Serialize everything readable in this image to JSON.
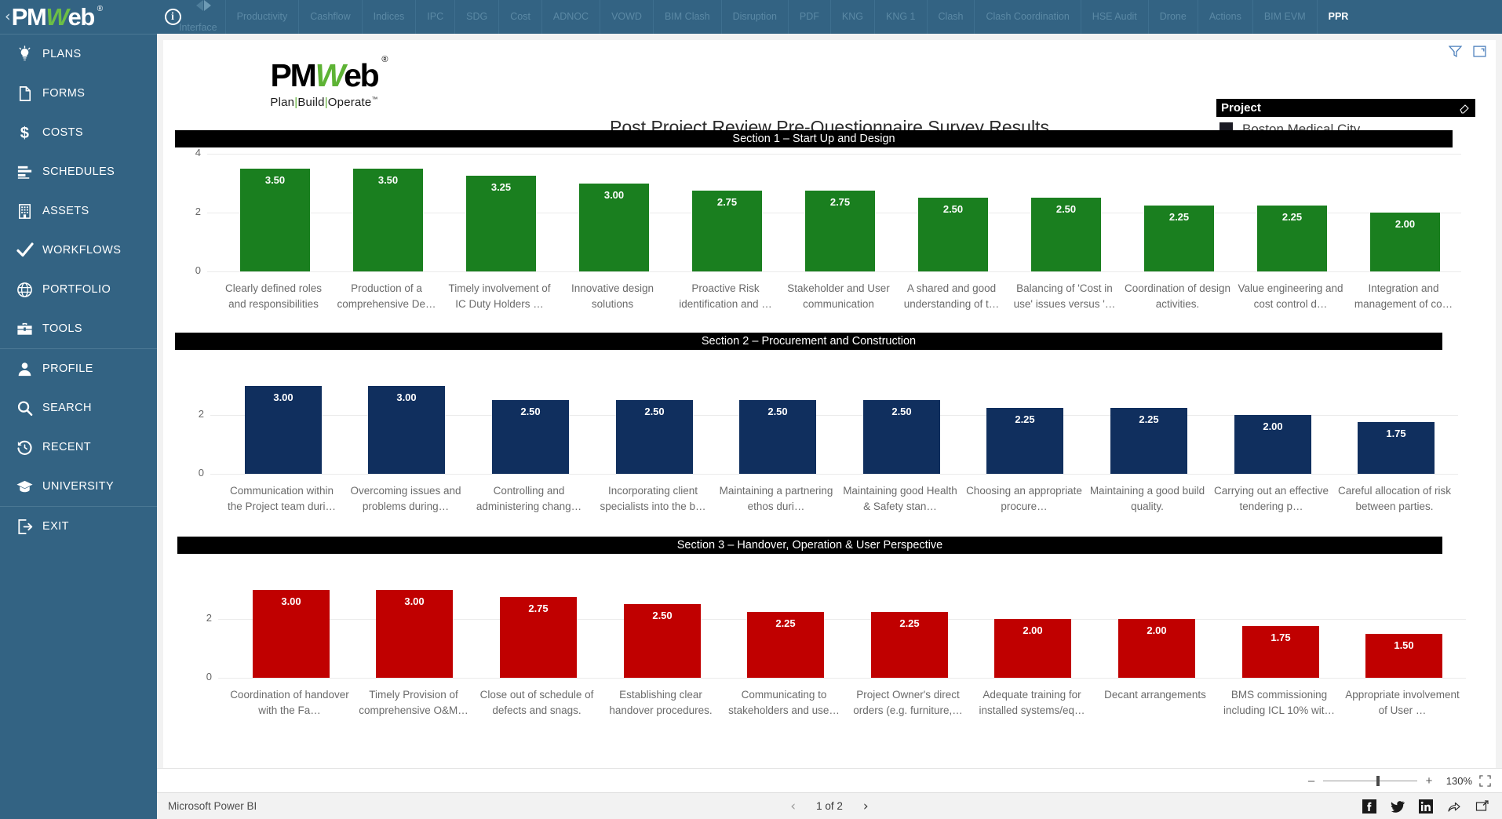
{
  "brand": {
    "chevron": "‹",
    "name_pm": "PM",
    "name_w": "W",
    "name_eb": "eb",
    "reg": "®"
  },
  "topbar": {
    "info_icon": "i",
    "tabs": [
      {
        "label": "Interface",
        "active": false,
        "nav": true
      },
      {
        "label": "Productivity",
        "active": false
      },
      {
        "label": "Cashflow",
        "active": false
      },
      {
        "label": "Indices",
        "active": false
      },
      {
        "label": "IPC",
        "active": false
      },
      {
        "label": "SDG",
        "active": false
      },
      {
        "label": "Cost",
        "active": false
      },
      {
        "label": "ADNOC",
        "active": false
      },
      {
        "label": "VOWD",
        "active": false
      },
      {
        "label": "BIM Clash",
        "active": false
      },
      {
        "label": "Disruption",
        "active": false
      },
      {
        "label": "PDF",
        "active": false
      },
      {
        "label": "KNG",
        "active": false
      },
      {
        "label": "KNG 1",
        "active": false
      },
      {
        "label": "Clash",
        "active": false
      },
      {
        "label": "Clash Coordination",
        "active": false
      },
      {
        "label": "HSE Audit",
        "active": false
      },
      {
        "label": "Drone",
        "active": false
      },
      {
        "label": "Actions",
        "active": false
      },
      {
        "label": "BIM EVM",
        "active": false
      },
      {
        "label": "PPR",
        "active": true
      }
    ]
  },
  "sidebar": {
    "items": [
      {
        "label": "PLANS",
        "icon": "lightbulb-icon"
      },
      {
        "label": "FORMS",
        "icon": "document-icon"
      },
      {
        "label": "COSTS",
        "icon": "dollar-icon"
      },
      {
        "label": "SCHEDULES",
        "icon": "gantt-icon"
      },
      {
        "label": "ASSETS",
        "icon": "building-icon"
      },
      {
        "label": "WORKFLOWS",
        "icon": "check-icon"
      },
      {
        "label": "PORTFOLIO",
        "icon": "globe-icon"
      },
      {
        "label": "TOOLS",
        "icon": "toolbox-icon"
      }
    ],
    "items2": [
      {
        "label": "PROFILE",
        "icon": "person-icon"
      },
      {
        "label": "SEARCH",
        "icon": "magnifier-icon"
      },
      {
        "label": "RECENT",
        "icon": "history-icon"
      },
      {
        "label": "UNIVERSITY",
        "icon": "graduation-cap-icon"
      }
    ],
    "items3": [
      {
        "label": "EXIT",
        "icon": "exit-icon"
      }
    ]
  },
  "report": {
    "logo": {
      "pm": "PM",
      "w": "W",
      "eb": "eb",
      "reg": "®",
      "tagline_plan": "Plan",
      "tagline_build": "Build",
      "tagline_operate": "Operate",
      "tm": "™",
      "sep": "|"
    },
    "title": "Post Project Review Pre-Questionnaire Survey Results",
    "slicer": {
      "header": "Project",
      "eraser_icon": "eraser-icon",
      "value": "Boston Medical City"
    },
    "toolbar": {
      "filter_icon": "filter-icon",
      "focus_icon": "focus-mode-icon"
    }
  },
  "zoombar": {
    "minus": "–",
    "plus": "+",
    "percent": "130%",
    "fit_icon": "fit-to-page-icon"
  },
  "statusbar": {
    "product": "Microsoft Power BI",
    "prev_icon": "chevron-left-icon",
    "next_icon": "chevron-right-icon",
    "page": "1 of 2",
    "share_icons": [
      "facebook-icon",
      "twitter-icon",
      "linkedin-icon",
      "share-icon",
      "popout-icon"
    ]
  },
  "chart_data": [
    {
      "type": "bar",
      "title": "Section 1 – Start Up and Design",
      "color": "#1a7f1f",
      "ylim": [
        0,
        4
      ],
      "yticks": [
        0,
        2,
        4
      ],
      "grid": true,
      "xlabel": "",
      "ylabel": "",
      "categories": [
        "Clearly defined roles and responsibilities",
        "Production of a comprehensive De…",
        "Timely involvement of IC Duty Holders …",
        "Innovative design solutions",
        "Proactive Risk identification and …",
        "Stakeholder and User communication",
        "A shared and good understanding of t…",
        "Balancing of 'Cost in use' issues versus '…",
        "Coordination of design activities.",
        "Value engineering and cost control d…",
        "Integration and management of co…"
      ],
      "values": [
        3.5,
        3.5,
        3.25,
        3.0,
        2.75,
        2.75,
        2.5,
        2.5,
        2.25,
        2.25,
        2.0
      ],
      "labels": [
        "3.50",
        "3.50",
        "3.25",
        "3.00",
        "2.75",
        "2.75",
        "2.50",
        "2.50",
        "2.25",
        "2.25",
        "2.00"
      ]
    },
    {
      "type": "bar",
      "title": "Section 2 – Procurement and Construction",
      "color": "#102f5e",
      "ylim": [
        0,
        4
      ],
      "yticks": [
        0,
        2
      ],
      "grid": true,
      "xlabel": "",
      "ylabel": "",
      "categories": [
        "Communication within the Project team duri…",
        "Overcoming issues and problems during…",
        "Controlling and administering chang…",
        "Incorporating client specialists into the b…",
        "Maintaining a partnering ethos duri…",
        "Maintaining good Health & Safety stan…",
        "Choosing an appropriate procure…",
        "Maintaining a good build quality.",
        "Carrying out an effective tendering p…",
        "Careful allocation of risk between parties."
      ],
      "values": [
        3.0,
        3.0,
        2.5,
        2.5,
        2.5,
        2.5,
        2.25,
        2.25,
        2.0,
        1.75
      ],
      "labels": [
        "3.00",
        "3.00",
        "2.50",
        "2.50",
        "2.50",
        "2.50",
        "2.25",
        "2.25",
        "2.00",
        "1.75"
      ]
    },
    {
      "type": "bar",
      "title": "Section 3 – Handover, Operation & User Perspective",
      "color": "#c00000",
      "ylim": [
        0,
        4
      ],
      "yticks": [
        0,
        2
      ],
      "grid": true,
      "xlabel": "",
      "ylabel": "",
      "categories": [
        "Coordination of handover with the Fa…",
        "Timely Provision of comprehensive O&M…",
        "Close out of schedule of defects and snags.",
        "Establishing clear handover procedures.",
        "Communicating to stakeholders and use…",
        "Project Owner's direct orders (e.g. furniture,…",
        "Adequate training for installed systems/eq…",
        "Decant arrangements",
        "BMS commissioning including ICL 10% wit…",
        "Appropriate involvement of User …"
      ],
      "values": [
        3.0,
        3.0,
        2.75,
        2.5,
        2.25,
        2.25,
        2.0,
        2.0,
        1.75,
        1.5
      ],
      "labels": [
        "3.00",
        "3.00",
        "2.75",
        "2.50",
        "2.25",
        "2.25",
        "2.00",
        "2.00",
        "1.75",
        "1.50"
      ]
    }
  ]
}
